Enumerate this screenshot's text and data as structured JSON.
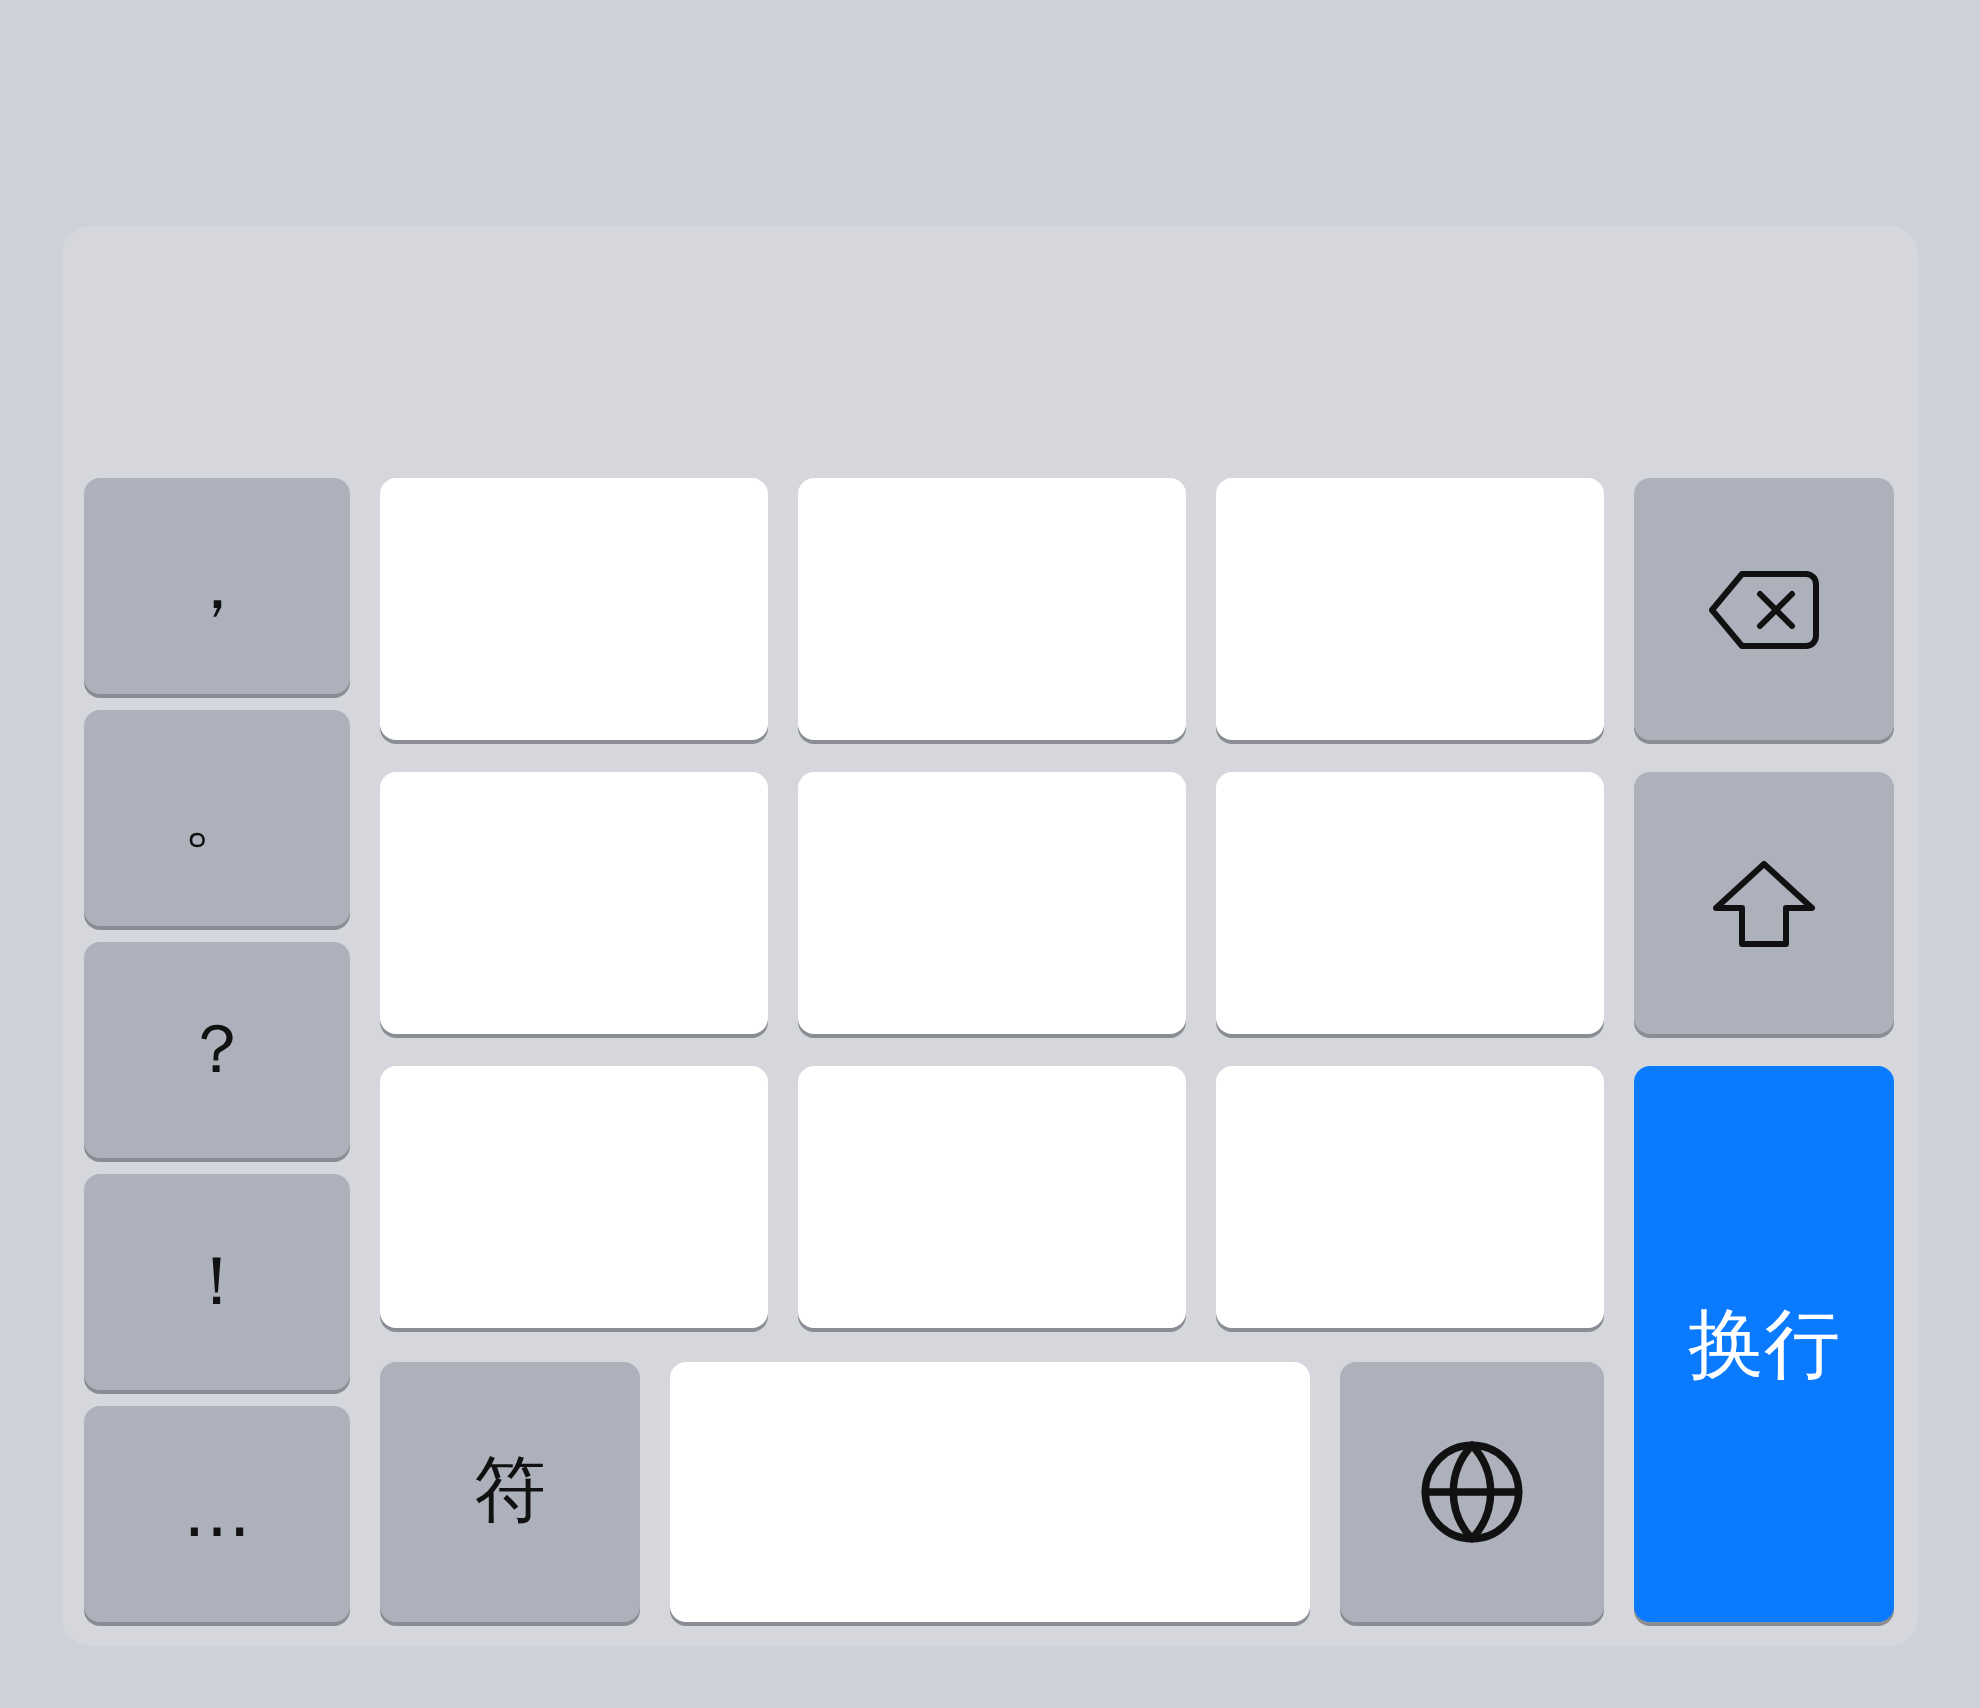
{
  "punctuation_keys": [
    {
      "label": "，"
    },
    {
      "label": "。"
    },
    {
      "label": "？"
    },
    {
      "label": "！"
    },
    {
      "label": "…"
    }
  ],
  "bottom_keys": [
    {
      "kind": "label",
      "label": "符"
    },
    {
      "kind": "space"
    },
    {
      "kind": "globe"
    }
  ],
  "side_keys": [
    {
      "kind": "delete"
    },
    {
      "kind": "shift"
    },
    {
      "kind": "return",
      "label": "换行"
    }
  ]
}
